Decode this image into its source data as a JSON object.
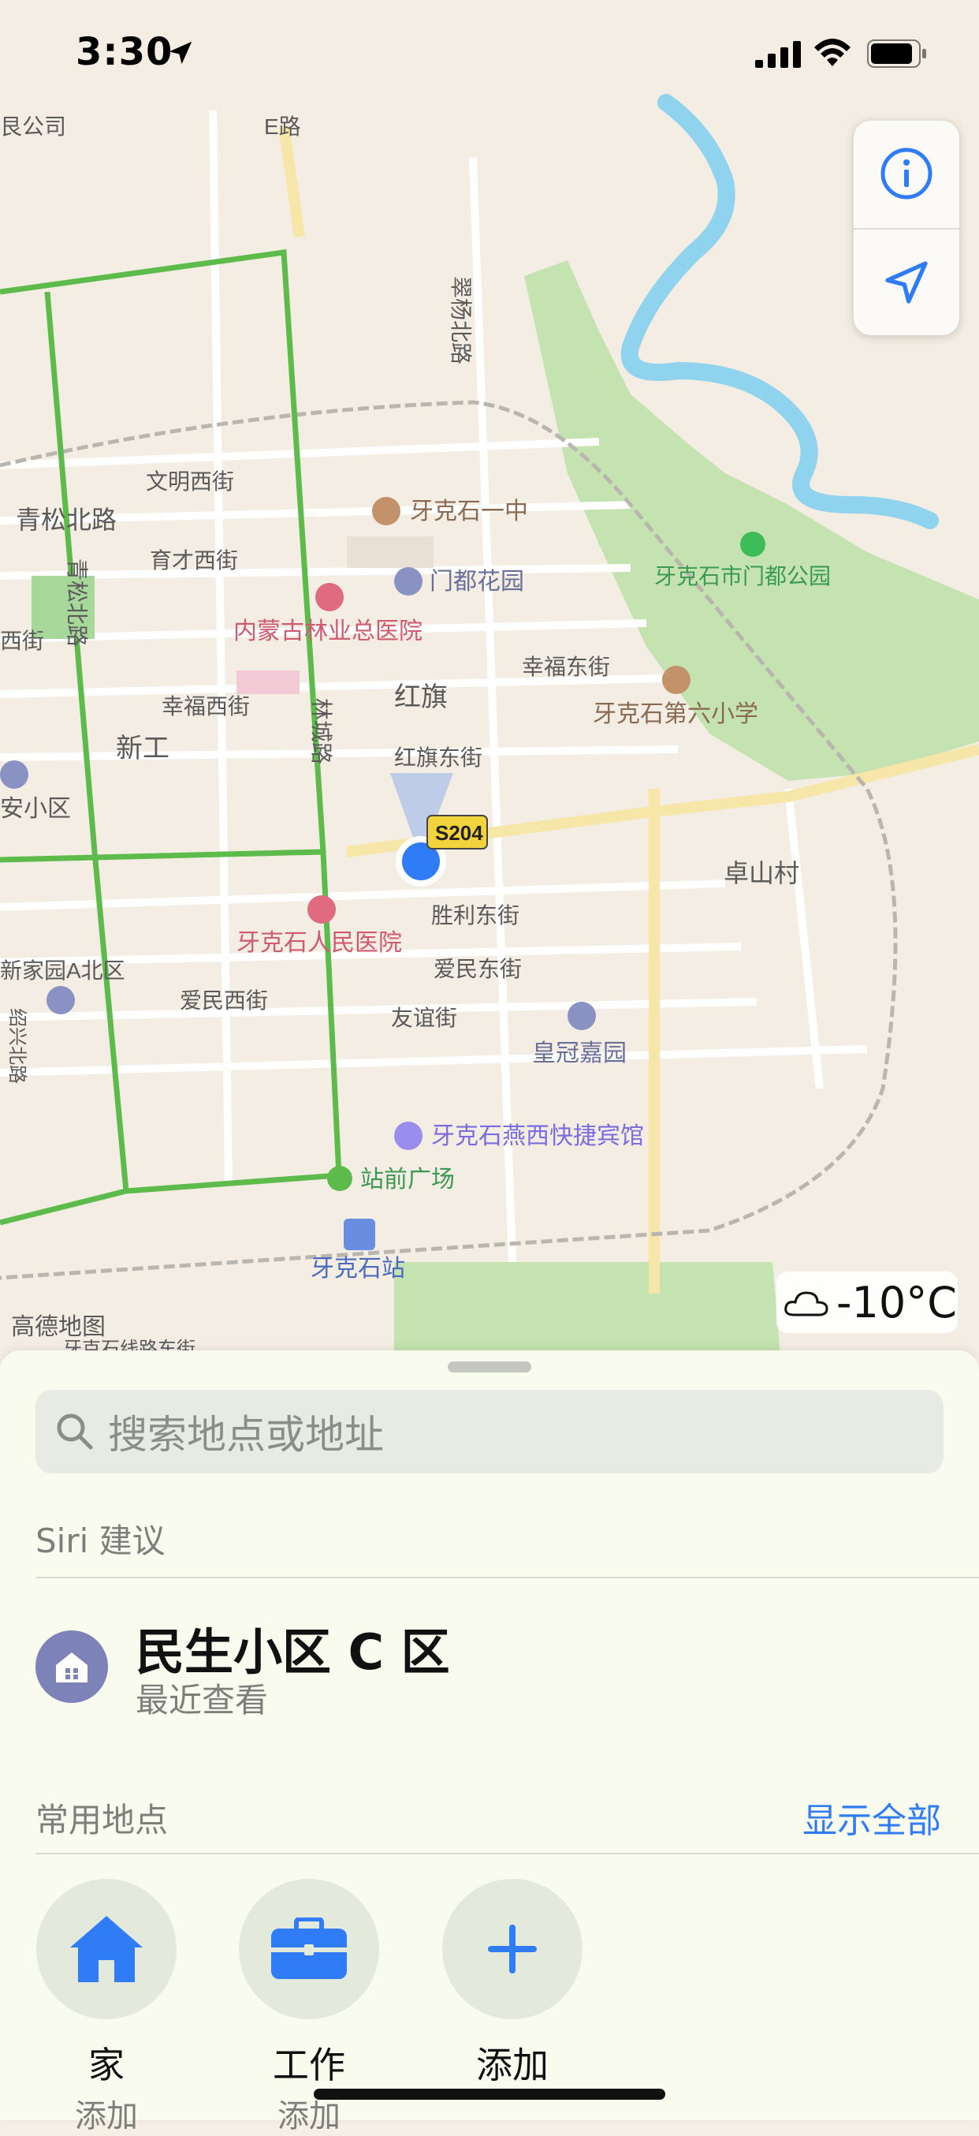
{
  "status_bar": {
    "time": "3:30"
  },
  "map": {
    "labels": {
      "company": "艮公司",
      "road_top": "E路",
      "cuiyang": "翠杨北路",
      "wenming": "文明西街",
      "qingsong_h": "青松北路",
      "qingsong_v": "青松北路",
      "yucai": "育才西街",
      "yakeshi_no1": "牙克石一中",
      "mendu_garden": "门都花园",
      "mendu_park": "牙克石市门都公园",
      "forestry_hospital": "内蒙古林业总医院",
      "xi": "西街",
      "xingfu_e": "幸福东街",
      "xingfu_w": "幸福西街",
      "hongqi": "红旗",
      "sixth_school": "牙克石第六小学",
      "xingong": "新工",
      "lincheng": "林城路",
      "hongqi_e": "红旗东街",
      "an_community": "安小区",
      "s204": "S204",
      "zhuoshan": "卓山村",
      "people_hospital": "牙克石人民医院",
      "shengli": "胜利东街",
      "xinjiayuan": "新家园A北区",
      "aimin_e": "爱民东街",
      "aimin_w": "爱民西街",
      "youyi": "友谊街",
      "huangguan": "皇冠嘉园",
      "shaoxing": "绍兴北路",
      "yanxi_hotel": "牙克石燕西快捷宾馆",
      "station_square": "站前广场",
      "station": "牙克石站",
      "gaode": "高德地图",
      "bottom_road": "牙克石线路东街"
    }
  },
  "weather": {
    "temperature": "-10°C",
    "icon": "cloud-icon"
  },
  "sheet": {
    "search_placeholder": "搜索地点或地址",
    "siri_label": "Siri 建议",
    "suggestion": {
      "title": "民生小区 C 区",
      "subtitle": "最近查看",
      "icon": "home-community-icon"
    },
    "favorites_label": "常用地点",
    "show_all": "显示全部",
    "favorites": [
      {
        "label": "家",
        "sub": "添加",
        "icon": "house-icon"
      },
      {
        "label": "工作",
        "sub": "添加",
        "icon": "briefcase-icon"
      },
      {
        "label": "添加",
        "sub": "",
        "icon": "plus-icon"
      }
    ]
  },
  "colors": {
    "accent": "#2f7cf6",
    "route_green": "#5cbb4a",
    "park": "#c4e3b0",
    "water": "#8fd3ee"
  }
}
